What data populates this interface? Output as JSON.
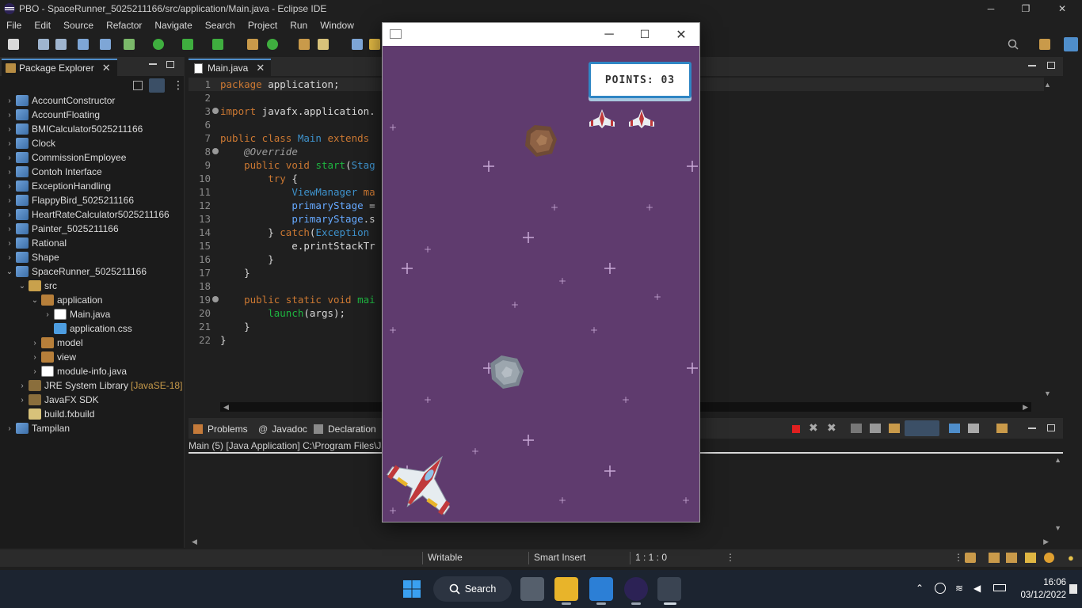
{
  "window": {
    "title": "PBO - SpaceRunner_5025211166/src/application/Main.java - Eclipse IDE",
    "minimize": "─",
    "restore": "❐",
    "close": "✕"
  },
  "menu": [
    "File",
    "Edit",
    "Source",
    "Refactor",
    "Navigate",
    "Search",
    "Project",
    "Run",
    "Window"
  ],
  "package_explorer": {
    "tab_label": "Package Explorer",
    "tree": [
      {
        "label": "AccountConstructor",
        "depth": 0,
        "arrow": "›",
        "icon": "project-icon"
      },
      {
        "label": "AccountFloating",
        "depth": 0,
        "arrow": "›",
        "icon": "project-icon"
      },
      {
        "label": "BMICalculator5025211166",
        "depth": 0,
        "arrow": "›",
        "icon": "project-icon"
      },
      {
        "label": "Clock",
        "depth": 0,
        "arrow": "›",
        "icon": "project-icon"
      },
      {
        "label": "CommissionEmployee",
        "depth": 0,
        "arrow": "›",
        "icon": "project-icon"
      },
      {
        "label": "Contoh Interface",
        "depth": 0,
        "arrow": "›",
        "icon": "project-icon"
      },
      {
        "label": "ExceptionHandling",
        "depth": 0,
        "arrow": "›",
        "icon": "project-icon"
      },
      {
        "label": "FlappyBird_5025211166",
        "depth": 0,
        "arrow": "›",
        "icon": "project-icon"
      },
      {
        "label": "HeartRateCalculator5025211166",
        "depth": 0,
        "arrow": "›",
        "icon": "project-icon"
      },
      {
        "label": "Painter_5025211166",
        "depth": 0,
        "arrow": "›",
        "icon": "project-icon"
      },
      {
        "label": "Rational",
        "depth": 0,
        "arrow": "›",
        "icon": "project-icon"
      },
      {
        "label": "Shape",
        "depth": 0,
        "arrow": "›",
        "icon": "project-icon"
      },
      {
        "label": "SpaceRunner_5025211166",
        "depth": 0,
        "arrow": "⌄",
        "icon": "project-icon"
      },
      {
        "label": "src",
        "depth": 1,
        "arrow": "⌄",
        "icon": "folder-icon"
      },
      {
        "label": "application",
        "depth": 2,
        "arrow": "⌄",
        "icon": "package-icon"
      },
      {
        "label": "Main.java",
        "depth": 3,
        "arrow": "›",
        "icon": "java-file-icon"
      },
      {
        "label": "application.css",
        "depth": 3,
        "arrow": "",
        "icon": "css-file-icon"
      },
      {
        "label": "model",
        "depth": 2,
        "arrow": "›",
        "icon": "package-icon"
      },
      {
        "label": "view",
        "depth": 2,
        "arrow": "›",
        "icon": "package-icon"
      },
      {
        "label": "module-info.java",
        "depth": 2,
        "arrow": "›",
        "icon": "java-file-icon"
      },
      {
        "label": "JRE System Library",
        "decoration": "[JavaSE-18]",
        "depth": 1,
        "arrow": "›",
        "icon": "library-icon"
      },
      {
        "label": "JavaFX SDK",
        "depth": 1,
        "arrow": "›",
        "icon": "library-icon"
      },
      {
        "label": "build.fxbuild",
        "depth": 1,
        "arrow": "",
        "icon": "build-file-icon"
      },
      {
        "label": "Tampilan",
        "depth": 0,
        "arrow": "›",
        "icon": "project-icon"
      }
    ]
  },
  "editor": {
    "tab_label": "Main.java",
    "lines": [
      {
        "n": "1",
        "html": "<span class=\"kw\">package</span> application;"
      },
      {
        "n": "2",
        "html": ""
      },
      {
        "n": "3",
        "html": "<span class=\"kw\">import</span> javafx.application."
      },
      {
        "n": "6",
        "html": ""
      },
      {
        "n": "7",
        "html": "<span class=\"kw\">public class</span> <span class=\"cls\">Main</span> <span class=\"kw\">extends</span>"
      },
      {
        "n": "8",
        "html": "    <span class=\"ann\">@Override</span>"
      },
      {
        "n": "9",
        "html": "    <span class=\"kw\">public void</span> <span class=\"fn\">start</span>(<span class=\"cls\">Stag</span>"
      },
      {
        "n": "10",
        "html": "        <span class=\"kw\">try</span> {"
      },
      {
        "n": "11",
        "html": "            <span class=\"cls\">ViewManager</span> <span class=\"kw\">ma</span>"
      },
      {
        "n": "12",
        "html": "            <span class=\"fld\">primaryStage</span> ="
      },
      {
        "n": "13",
        "html": "            <span class=\"fld\">primaryStage</span>.s"
      },
      {
        "n": "14",
        "html": "        } <span class=\"kw\">catch</span>(<span class=\"cls\">Exception</span>"
      },
      {
        "n": "15",
        "html": "            e.printStackTr"
      },
      {
        "n": "16",
        "html": "        }"
      },
      {
        "n": "17",
        "html": "    }"
      },
      {
        "n": "18",
        "html": ""
      },
      {
        "n": "19",
        "html": "    <span class=\"kw\">public static void</span> <span class=\"fn\">mai</span>"
      },
      {
        "n": "20",
        "html": "        <span class=\"fn\">launch</span>(args);"
      },
      {
        "n": "21",
        "html": "    }"
      },
      {
        "n": "22",
        "html": "}"
      }
    ]
  },
  "bottom_panel": {
    "tabs": [
      "Problems",
      "Javadoc",
      "Declaration"
    ],
    "console_label": "Main (5) [Java Application] C:\\Program Files\\Ja"
  },
  "status_bar": {
    "writable": "Writable",
    "insert_mode": "Smart Insert",
    "position": "1 : 1 : 0"
  },
  "taskbar": {
    "search_label": "Search",
    "time": "16:06",
    "date": "03/12/2022"
  },
  "game": {
    "points_label": "POINTS: 03",
    "lives": 2
  },
  "colors": {
    "game_background": "#5f3b6e",
    "points_border": "#2f86c4",
    "accent": "#4f8ecb"
  }
}
